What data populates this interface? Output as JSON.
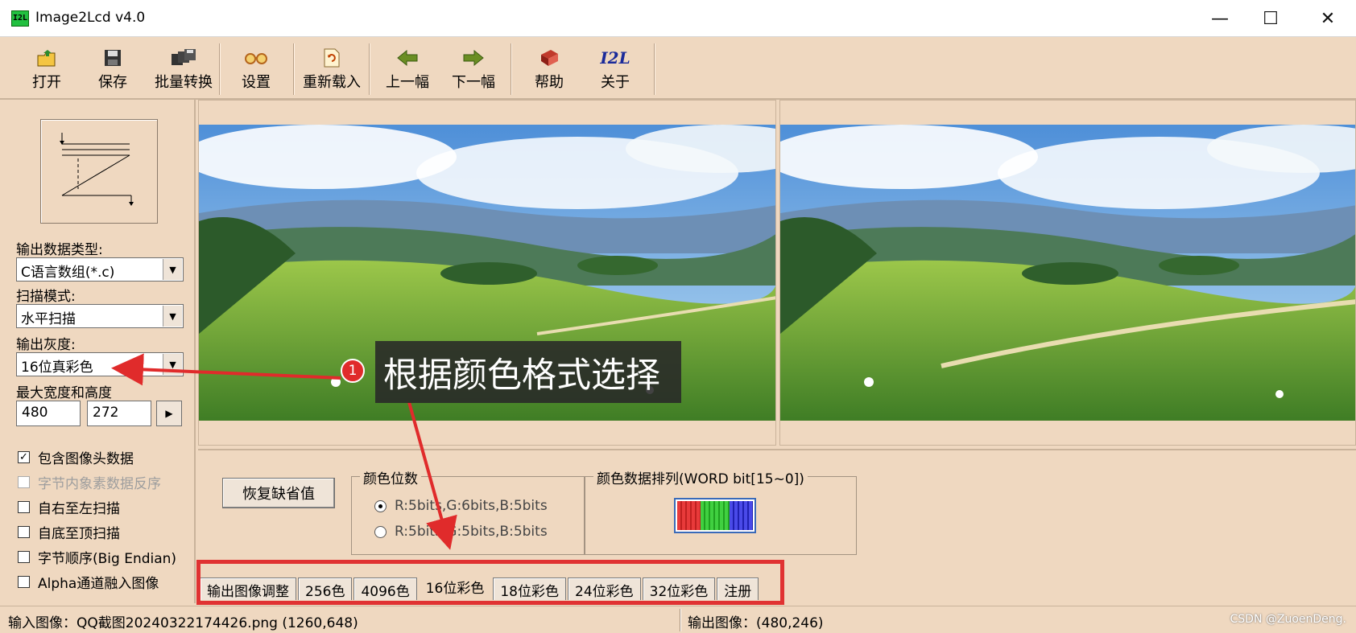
{
  "window": {
    "title": "Image2Lcd v4.0",
    "icon_text": "I2L"
  },
  "toolbar": {
    "items": [
      {
        "label": "打开",
        "icon": "open-icon"
      },
      {
        "label": "保存",
        "icon": "save-icon"
      },
      {
        "label": "批量转换",
        "icon": "batch-icon"
      },
      {
        "label": "设置",
        "icon": "settings-icon"
      },
      {
        "label": "重新载入",
        "icon": "reload-icon"
      },
      {
        "label": "上一幅",
        "icon": "prev-icon"
      },
      {
        "label": "下一幅",
        "icon": "next-icon"
      },
      {
        "label": "帮助",
        "icon": "help-icon"
      },
      {
        "label": "关于",
        "icon": "about-icon",
        "glyph": "I2L"
      }
    ]
  },
  "left": {
    "output_type_label": "输出数据类型:",
    "output_type_value": "C语言数组(*.c)",
    "scan_mode_label": "扫描模式:",
    "scan_mode_value": "水平扫描",
    "gray_label": "输出灰度:",
    "gray_value": "16位真彩色",
    "max_size_label": "最大宽度和高度",
    "max_width": "480",
    "max_height": "272",
    "checkboxes": [
      {
        "label": "包含图像头数据",
        "checked": true,
        "disabled": false
      },
      {
        "label": "字节内象素数据反序",
        "checked": false,
        "disabled": true
      },
      {
        "label": "自右至左扫描",
        "checked": false,
        "disabled": false
      },
      {
        "label": "自底至顶扫描",
        "checked": false,
        "disabled": false
      },
      {
        "label": "字节顺序(Big Endian)",
        "checked": false,
        "disabled": false
      },
      {
        "label": "Alpha通道融入图像",
        "checked": false,
        "disabled": false
      }
    ]
  },
  "lower": {
    "restore_label": "恢复缺省值",
    "color_bits_caption": "颜色位数",
    "radio_1": "R:5bits,G:6bits,B:5bits",
    "radio_2": "R:5bits,G:5bits,B:5bits",
    "arrangement_caption": "颜色数据排列(WORD bit[15~0])"
  },
  "tabs": [
    "输出图像调整",
    "256色",
    "4096色",
    "16位彩色",
    "18位彩色",
    "24位彩色",
    "32位彩色",
    "注册"
  ],
  "active_tab": "16位彩色",
  "status": {
    "input": "输入图像：QQ截图20240322174426.png (1260,648)",
    "output": "输出图像：(480,246)",
    "watermark": "CSDN @ZuoenDeng."
  },
  "annotation": {
    "badge": "1",
    "text": "根据颜色格式选择"
  },
  "colors": {
    "background": "#efd8c0",
    "highlight": "#e03232"
  }
}
